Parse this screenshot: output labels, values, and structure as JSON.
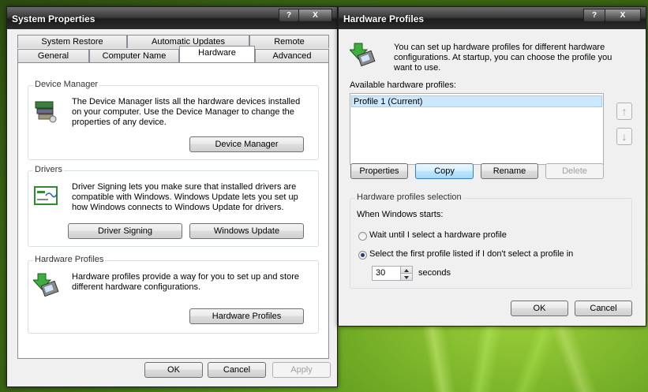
{
  "system_properties": {
    "title": "System Properties",
    "help_btn": "?",
    "close_btn": "X",
    "tabs_row1": [
      "System Restore",
      "Automatic Updates",
      "Remote"
    ],
    "tabs_row2": [
      "General",
      "Computer Name",
      "Hardware",
      "Advanced"
    ],
    "active_tab": "Hardware",
    "device_manager": {
      "label": "Device Manager",
      "text": "The Device Manager lists all the hardware devices installed on your computer. Use the Device Manager to change the properties of any device.",
      "button": "Device Manager"
    },
    "drivers": {
      "label": "Drivers",
      "text": "Driver Signing lets you make sure that installed drivers are compatible with Windows. Windows Update lets you set up how Windows connects to Windows Update for drivers.",
      "button_signing": "Driver Signing",
      "button_update": "Windows Update"
    },
    "hardware_profiles": {
      "label": "Hardware Profiles",
      "text": "Hardware profiles provide a way for you to set up and store different hardware configurations.",
      "button": "Hardware Profiles"
    },
    "ok": "OK",
    "cancel": "Cancel",
    "apply": "Apply"
  },
  "hardware_profiles_dialog": {
    "title": "Hardware Profiles",
    "help_btn": "?",
    "close_btn": "X",
    "intro": "You can set up hardware profiles for different hardware configurations.  At startup, you can choose the profile you want to use.",
    "available_label": "Available hardware profiles:",
    "profiles": [
      "Profile 1 (Current)"
    ],
    "up_arrow": "↑",
    "down_arrow": "↓",
    "buttons": {
      "properties": "Properties",
      "copy": "Copy",
      "rename": "Rename",
      "delete": "Delete"
    },
    "selection": {
      "label": "Hardware profiles selection",
      "when_starts": "When Windows starts:",
      "option_wait": "Wait until I select a hardware profile",
      "option_first": "Select the first profile listed if I don't select a profile in",
      "seconds_value": "30",
      "seconds_label": "seconds"
    },
    "ok": "OK",
    "cancel": "Cancel"
  }
}
